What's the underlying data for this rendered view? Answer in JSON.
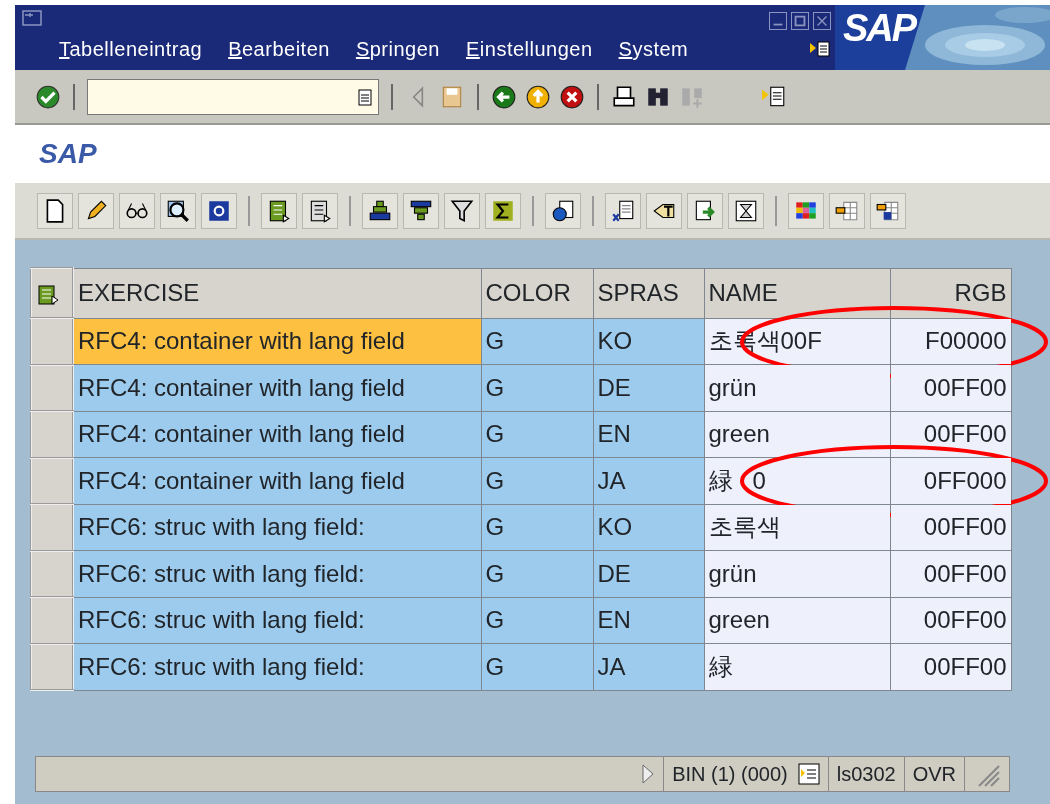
{
  "window": {
    "menu": [
      {
        "label": "Tabelleneintrag"
      },
      {
        "label": "Bearbeiten"
      },
      {
        "label": "Springen"
      },
      {
        "label": "Einstellungen"
      },
      {
        "label": "System"
      }
    ],
    "logo": "SAP"
  },
  "screen_title": "SAP",
  "table": {
    "columns": [
      "EXERCISE",
      "COLOR",
      "SPRAS",
      "NAME",
      "RGB"
    ],
    "rows": [
      {
        "cells": [
          "RFC4: container with lang field",
          "G",
          "KO",
          "초록색00F",
          "F00000"
        ],
        "selected": true,
        "circled": true
      },
      {
        "cells": [
          "RFC4: container with lang field",
          "G",
          "DE",
          "grün",
          "00FF00"
        ],
        "selected": false,
        "circled": false
      },
      {
        "cells": [
          "RFC4: container with lang field",
          "G",
          "EN",
          "green",
          "00FF00"
        ],
        "selected": false,
        "circled": false
      },
      {
        "cells": [
          "RFC4: container with lang field",
          "G",
          "JA",
          "緑   0",
          "0FF000"
        ],
        "selected": false,
        "circled": true
      },
      {
        "cells": [
          "RFC6: struc with lang field:",
          "G",
          "KO",
          "초록색",
          "00FF00"
        ],
        "selected": false,
        "circled": false
      },
      {
        "cells": [
          "RFC6: struc with lang field:",
          "G",
          "DE",
          "grün",
          "00FF00"
        ],
        "selected": false,
        "circled": false
      },
      {
        "cells": [
          "RFC6: struc with lang field:",
          "G",
          "EN",
          "green",
          "00FF00"
        ],
        "selected": false,
        "circled": false
      },
      {
        "cells": [
          "RFC6: struc with lang field:",
          "G",
          "JA",
          "緑",
          "00FF00"
        ],
        "selected": false,
        "circled": false
      }
    ]
  },
  "status_bar": {
    "items": [
      "BIN (1) (000)",
      "ls0302",
      "OVR"
    ]
  }
}
